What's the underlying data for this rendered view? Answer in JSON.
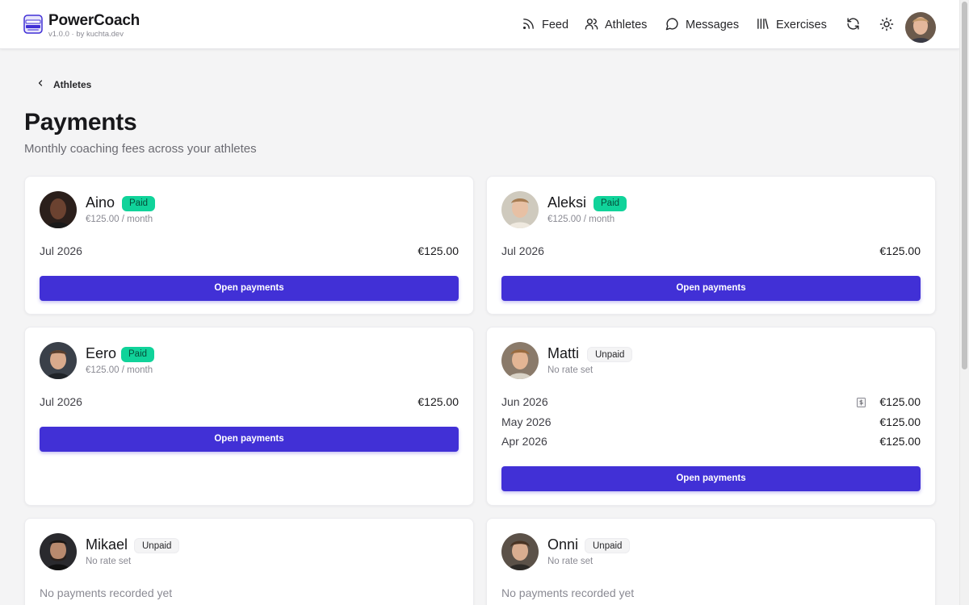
{
  "app": {
    "name": "PowerCoach",
    "version": "v1.0.0 · by kuchta.dev"
  },
  "nav": {
    "feed": "Feed",
    "athletes": "Athletes",
    "messages": "Messages",
    "exercises": "Exercises"
  },
  "breadcrumb": {
    "back_label": "Athletes"
  },
  "page": {
    "title": "Payments",
    "subtitle": "Monthly coaching fees across your athletes"
  },
  "button_label": "Open payments",
  "cards": [
    {
      "name": "Aino",
      "status": "Paid",
      "rate": "€125.00 / month",
      "payments": [
        {
          "month": "Jul 2026",
          "amount": "€125.00"
        }
      ]
    },
    {
      "name": "Aleksi",
      "status": "Paid",
      "rate": "€125.00 / month",
      "payments": [
        {
          "month": "Jul 2026",
          "amount": "€125.00"
        }
      ]
    },
    {
      "name": "Eero",
      "status": "Paid",
      "rate": "€125.00 / month",
      "payments": [
        {
          "month": "Jul 2026",
          "amount": "€125.00"
        }
      ]
    },
    {
      "name": "Matti",
      "status": "Unpaid",
      "rate": "No rate set",
      "payments": [
        {
          "month": "Jun 2026",
          "amount": "€125.00"
        },
        {
          "month": "May 2026",
          "amount": "€125.00"
        },
        {
          "month": "Apr 2026",
          "amount": "€125.00"
        }
      ]
    },
    {
      "name": "Mikael",
      "status": "Unpaid",
      "rate": "No rate set",
      "empty": "No payments recorded yet"
    },
    {
      "name": "Onni",
      "status": "Unpaid",
      "rate": "No rate set",
      "empty": "No payments recorded yet"
    }
  ],
  "colors": {
    "accent": "#4130d6",
    "paid_badge": "#10d39a",
    "background": "#f4f4f5"
  },
  "icons": {
    "logo": "barbell-logo-icon",
    "feed": "rss-icon",
    "athletes": "users-icon",
    "messages": "chat-bubble-icon",
    "exercises": "library-icon",
    "refresh": "refresh-icon",
    "theme": "sun-icon",
    "back": "chevron-left-icon",
    "receipt": "receipt-icon"
  }
}
